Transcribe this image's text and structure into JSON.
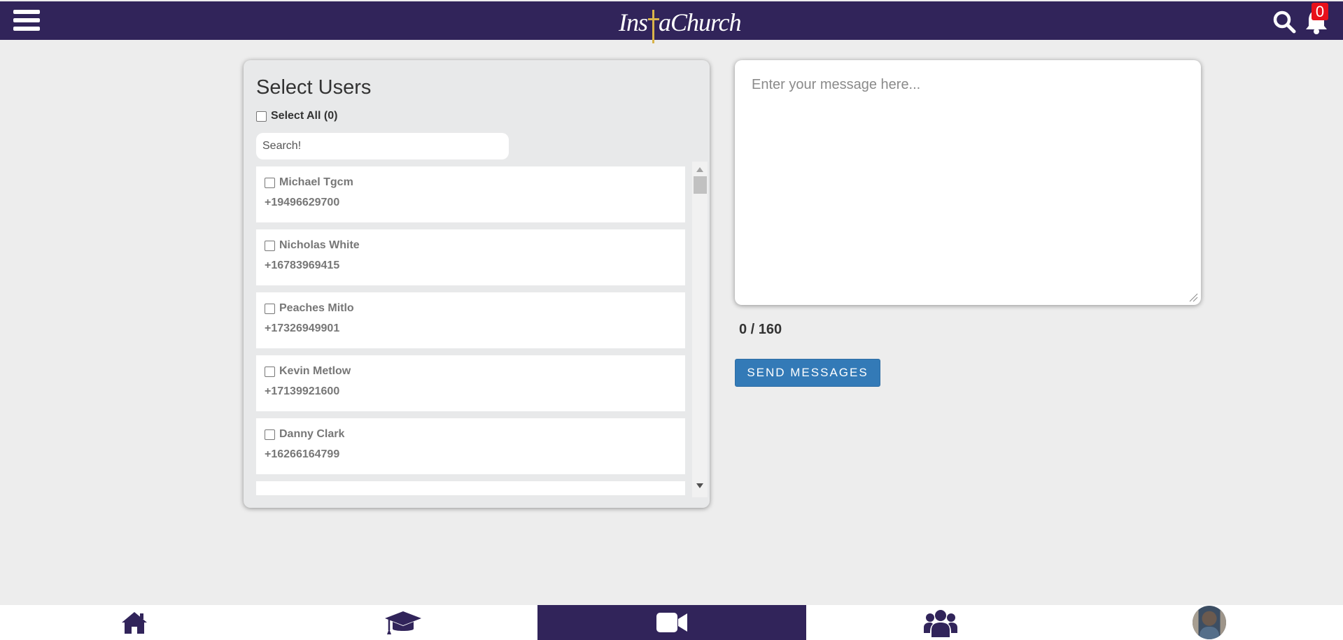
{
  "header": {
    "logo_text_left": "Ins",
    "logo_text_right": "aChurch",
    "notification_count": "0",
    "brand_color": "#31245a",
    "icons": [
      "menu-icon",
      "search-icon",
      "bell-icon"
    ]
  },
  "panel": {
    "title": "Select Users",
    "select_all_label": "Select All (0)",
    "search_placeholder": "Search!",
    "users": [
      {
        "name": "Michael Tgcm",
        "phone": "+19496629700"
      },
      {
        "name": "Nicholas White",
        "phone": "+16783969415"
      },
      {
        "name": "Peaches Mitlo",
        "phone": "+17326949901"
      },
      {
        "name": "Kevin Metlow",
        "phone": "+17139921600"
      },
      {
        "name": "Danny Clark",
        "phone": "+16266164799"
      }
    ]
  },
  "compose": {
    "message_placeholder": "Enter your message here...",
    "counter": "0 / 160",
    "send_label": "SEND MESSAGES",
    "send_color": "#337ab7"
  },
  "bottom_nav": {
    "items": [
      "home-icon",
      "graduation-cap-icon",
      "video-camera-icon",
      "users-group-icon",
      "avatar"
    ],
    "active": "video-camera-icon"
  }
}
